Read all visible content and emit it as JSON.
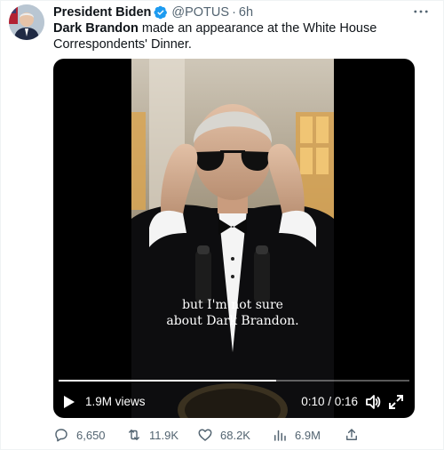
{
  "author": {
    "name": "President Biden",
    "handle": "@POTUS",
    "separator": "·",
    "time": "6h",
    "verified": true
  },
  "post": {
    "bold": "Dark Brandon",
    "rest": " made an appearance at the White House Correspondents' Dinner."
  },
  "video": {
    "caption_line1": "but I'm not sure",
    "caption_line2": "about Dark Brandon.",
    "views": "1.9M views",
    "timecode": "0:10 / 0:16",
    "progress": 0.62
  },
  "actions": {
    "replies": "6,650",
    "retweets": "11.9K",
    "likes": "68.2K",
    "views": "6.9M"
  },
  "colors": {
    "verified": "#1d9bf0",
    "muted": "#536471",
    "text": "#0f1419"
  },
  "icons": [
    "more-icon",
    "verified-icon",
    "play-icon",
    "volume-icon",
    "fullscreen-icon",
    "reply-icon",
    "retweet-icon",
    "like-icon",
    "analytics-icon",
    "share-icon"
  ]
}
